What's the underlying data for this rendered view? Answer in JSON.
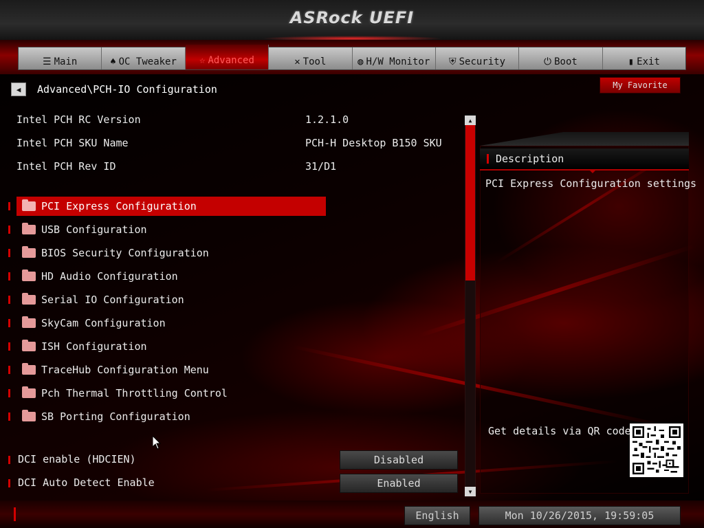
{
  "header": {
    "logo": "ASRock UEFI"
  },
  "menu": {
    "tabs": [
      {
        "label": "Main",
        "icon": "list-icon",
        "glyph": "☰"
      },
      {
        "label": "OC Tweaker",
        "icon": "rocket-icon",
        "glyph": "♠"
      },
      {
        "label": "Advanced",
        "icon": "star-icon",
        "glyph": "☆"
      },
      {
        "label": "Tool",
        "icon": "tool-icon",
        "glyph": "✕"
      },
      {
        "label": "H/W Monitor",
        "icon": "monitor-icon",
        "glyph": "◍"
      },
      {
        "label": "Security",
        "icon": "shield-icon",
        "glyph": "⛨"
      },
      {
        "label": "Boot",
        "icon": "power-icon",
        "glyph": "⏻"
      },
      {
        "label": "Exit",
        "icon": "door-icon",
        "glyph": "▮"
      }
    ],
    "active": "Advanced"
  },
  "breadcrumb": "Advanced\\PCH-IO Configuration",
  "favorite_label": "My Favorite",
  "info": [
    {
      "label": "Intel PCH RC Version",
      "value": "1.2.1.0"
    },
    {
      "label": "Intel PCH SKU Name",
      "value": "PCH-H Desktop B150 SKU"
    },
    {
      "label": "Intel PCH Rev ID",
      "value": "31/D1"
    }
  ],
  "items": [
    "PCI Express Configuration",
    "USB Configuration",
    "BIOS Security Configuration",
    "HD Audio Configuration",
    "Serial IO Configuration",
    "SkyCam Configuration",
    "ISH Configuration",
    "TraceHub Configuration Menu",
    "Pch Thermal Throttling Control",
    "SB Porting Configuration"
  ],
  "selected_item": "PCI Express Configuration",
  "options": [
    {
      "label": "DCI enable (HDCIEN)",
      "value": "Disabled"
    },
    {
      "label": "DCI Auto Detect Enable",
      "value": "Enabled"
    }
  ],
  "description": {
    "title": "Description",
    "text": "PCI Express Configuration settings",
    "qr_label": "Get details via QR code"
  },
  "status": {
    "language": "English",
    "datetime": "Mon 10/26/2015, 19:59:05"
  },
  "colors": {
    "accent": "#c40000",
    "background": "#050000",
    "text": "#ececec"
  }
}
